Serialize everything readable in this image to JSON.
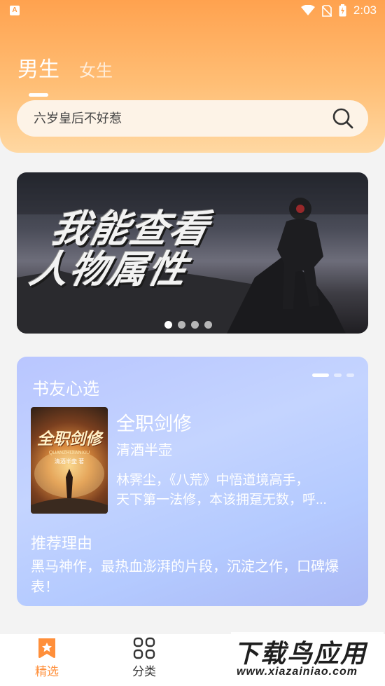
{
  "status_bar": {
    "time": "2:03",
    "app_badge": "A"
  },
  "tabs": [
    {
      "label": "男生",
      "active": true
    },
    {
      "label": "女生",
      "active": false
    }
  ],
  "search": {
    "value": "六岁皇后不好惹"
  },
  "banner": {
    "title_line1": "我能查看",
    "title_line2": "人物属性",
    "dots": 4,
    "active_dot": 0
  },
  "recommend": {
    "title": "书友心选",
    "book": {
      "name": "全职剑修",
      "author": "清酒半壶",
      "description_line1": "林霁尘，《八荒》中悟道境高手，",
      "description_line2": "天下第一法修，本该拥趸无数，呼...",
      "cover_title": "全职剑修",
      "cover_subtitle": "QUANZHIJIANXIU",
      "cover_author": "清酒半壶 著"
    },
    "reason_title": "推荐理由",
    "reason_text": "黑马神作，最热血澎湃的片段，沉淀之作，口碑爆表！"
  },
  "nav": [
    {
      "label": "精选",
      "icon": "bookmark-star-icon",
      "active": true
    },
    {
      "label": "分类",
      "icon": "grid-icon",
      "active": false
    }
  ],
  "watermark": {
    "main": "下载鸟应用",
    "sub": "www.xiazainiao.com"
  },
  "colors": {
    "accent": "#ff8f3a",
    "header_top": "#ffa24f",
    "card": "#b9c6ff"
  }
}
